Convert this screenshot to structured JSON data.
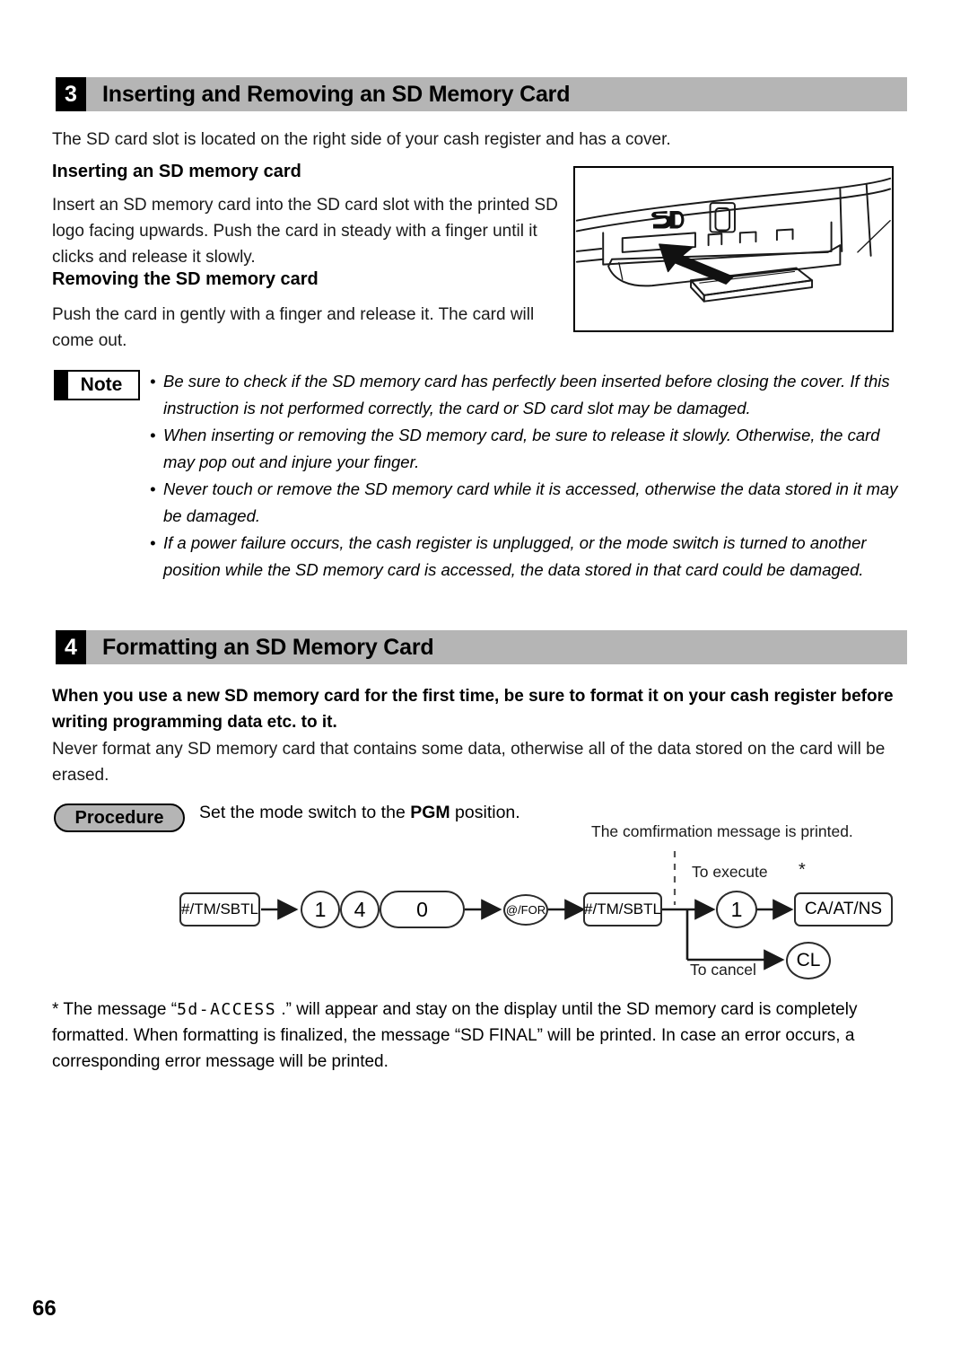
{
  "page": {
    "number": "66"
  },
  "sections": [
    {
      "number": "3",
      "title": "Inserting and Removing an SD Memory Card",
      "intro": "The SD card slot is located on the right side of your cash register and has a cover.",
      "sub1_head": "Inserting an SD memory card",
      "sub1_body": "Insert an SD memory card into the SD card slot with the printed SD logo facing upwards. Push the card in steady with a finger until it clicks and release it slowly.",
      "sub2_head": "Removing the SD memory card",
      "sub2_body": "Push the card in gently with a finger and release it. The card will come out.",
      "illustration_alt": "SD card being inserted into the card slot of the cash register, SD logo visible above the slot"
    },
    {
      "number": "4",
      "title": "Formatting an SD Memory Card",
      "bold_intro": "When you use a new SD memory card for the first time, be sure to format it on your cash register before writing programming data etc. to it.",
      "body": "Never format any SD memory card that contains some data, otherwise all of the data stored on the card will be erased."
    }
  ],
  "note": {
    "label": "Note",
    "items": [
      "Be sure to check if the SD memory card has perfectly been inserted before closing the cover. If this instruction is not performed correctly, the card or SD card slot may be damaged.",
      "When inserting or removing the SD memory card, be sure to release it slowly. Otherwise, the card may pop out and injure your finger.",
      "Never touch or remove the SD memory card while it is accessed, otherwise the data stored in it may be damaged.",
      "If a power failure occurs, the cash register is unplugged, or the mode switch is turned to another position while the SD memory card is accessed, the data stored in that card could be damaged."
    ]
  },
  "procedure": {
    "label": "Procedure",
    "instruction_pre": "Set the mode switch to the ",
    "instruction_bold": "PGM",
    "instruction_post": " position.",
    "diagram": {
      "confirmation_label": "The comfirmation message is printed.",
      "execute_label": "To execute",
      "cancel_label": "To cancel",
      "star": "*",
      "keys": [
        {
          "label": "#/TM/SBTL",
          "shape": "rect"
        },
        {
          "label": "1",
          "shape": "circle"
        },
        {
          "label": "4",
          "shape": "circle"
        },
        {
          "label": "0",
          "shape": "pill"
        },
        {
          "label": "@/FOR",
          "shape": "circle"
        },
        {
          "label": "#/TM/SBTL",
          "shape": "rect"
        },
        {
          "label": "1",
          "shape": "circle"
        },
        {
          "label": "CA/AT/NS",
          "shape": "rect"
        },
        {
          "label": "CL",
          "shape": "circle"
        }
      ]
    }
  },
  "footnote": {
    "marker": "*",
    "pre": "The message “",
    "lcd_message": "5d-ACCESS",
    "post": " .” will appear and stay on the display until the SD memory card is completely formatted. When formatting is finalized, the message “SD FINAL” will be printed. In case an error occurs, a corresponding error message will be printed."
  }
}
